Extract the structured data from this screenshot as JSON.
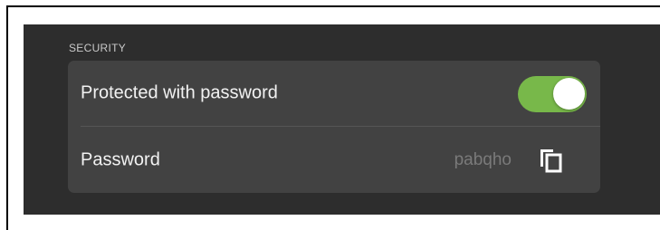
{
  "section": {
    "header": "SECURITY"
  },
  "rows": {
    "protected": {
      "label": "Protected with password",
      "toggle_on": true,
      "toggle_color": "#78b84a"
    },
    "password": {
      "label": "Password",
      "value": "pabqho",
      "copy_icon": "copy-icon"
    }
  },
  "colors": {
    "background": "#2d2d2d",
    "card": "#424242",
    "text": "#f2f2f2",
    "muted_text": "#7a7a7a"
  }
}
